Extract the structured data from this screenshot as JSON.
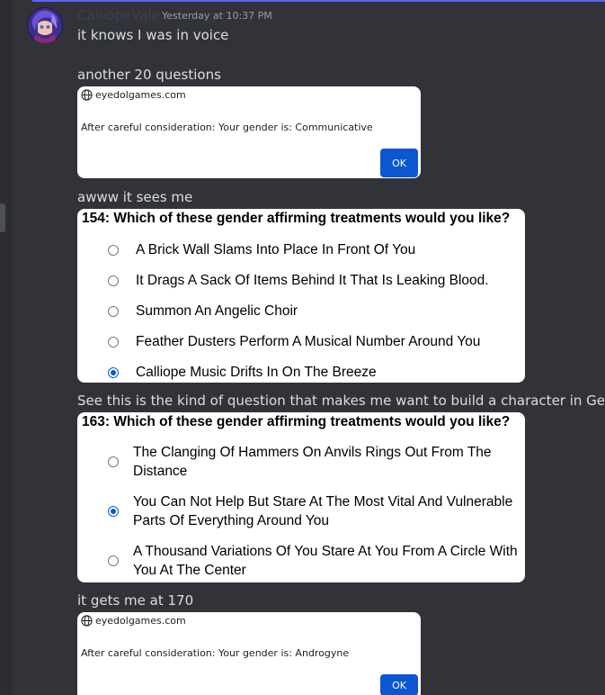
{
  "message": {
    "author": "CalliopeVale",
    "timestamp": "Yesterday at 10:37 PM",
    "line1": "it knows I was in voice",
    "line2": "another 20 questions",
    "line3": "awww it sees me",
    "line4": "See this is the kind of question that makes me want to build a character in Gendr",
    "line5": "it gets me at 170"
  },
  "dialog1": {
    "site": "eyedolgames.com",
    "text": "After careful consideration: Your gender is: Communicative",
    "ok_label": "OK"
  },
  "quiz1": {
    "question": "154: Which of these gender affirming treatments would you like?",
    "options": [
      {
        "label": "A Brick Wall Slams Into Place In Front Of You",
        "selected": false
      },
      {
        "label": "It Drags A Sack Of Items Behind It That Is Leaking Blood.",
        "selected": false
      },
      {
        "label": "Summon An Angelic Choir",
        "selected": false
      },
      {
        "label": "Feather Dusters Perform A Musical Number Around You",
        "selected": false
      },
      {
        "label": "Calliope Music Drifts In On The Breeze",
        "selected": true
      }
    ]
  },
  "quiz2": {
    "question": "163: Which of these gender affirming treatments would you like?",
    "options": [
      {
        "label": "The Clanging Of Hammers On Anvils Rings Out From The Distance",
        "selected": false
      },
      {
        "label": "You Can Not Help But Stare At The Most Vital And Vulnerable Parts Of Everything Around You",
        "selected": true
      },
      {
        "label": "A Thousand Variations Of You Stare At You From A Circle With You At The Center",
        "selected": false
      }
    ]
  },
  "dialog2": {
    "site": "eyedolgames.com",
    "text": "After careful consideration: Your gender is: Androgyne",
    "ok_label": "OK"
  }
}
